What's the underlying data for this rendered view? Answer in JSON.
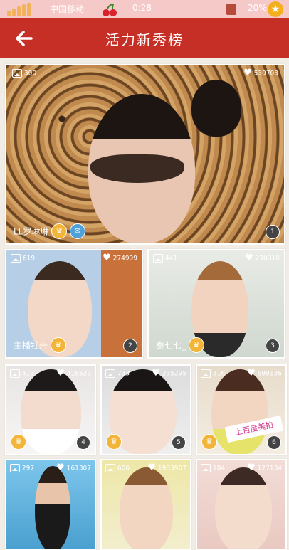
{
  "status_bar": {
    "carrier": "中国移动",
    "time": "0:28",
    "battery": "20%"
  },
  "header": {
    "title": "活力新秀榜"
  },
  "icons": {
    "back": "back-arrow-icon",
    "photos": "photo-count-icon",
    "likes": "heart-icon",
    "crown": "crown-icon",
    "mail": "mail-icon"
  },
  "colors": {
    "status_bar": "#f6c9c9",
    "title_bar": "#c62f25",
    "crown": "#f2b53a",
    "mail": "#4fa1d8"
  },
  "entries": [
    {
      "rank": "1",
      "name": "LL罗琳琳",
      "photos": "300",
      "likes": "539703"
    },
    {
      "rank": "2",
      "name": "主播牡丹",
      "photos": "619",
      "likes": "274999"
    },
    {
      "rank": "3",
      "name": "秦七七_",
      "photos": "441",
      "likes": "230310"
    },
    {
      "rank": "4",
      "name": "",
      "photos": "413",
      "likes": "418523"
    },
    {
      "rank": "5",
      "name": "",
      "photos": "733",
      "likes": "235295"
    },
    {
      "rank": "6",
      "name": "",
      "photos": "316",
      "likes": "699136"
    },
    {
      "rank": "",
      "name": "",
      "photos": "297",
      "likes": "161307"
    },
    {
      "rank": "",
      "name": "",
      "photos": "606",
      "likes": "1983907"
    },
    {
      "rank": "",
      "name": "",
      "photos": "184",
      "likes": "127134"
    }
  ],
  "sign_text": "上百度美拍"
}
